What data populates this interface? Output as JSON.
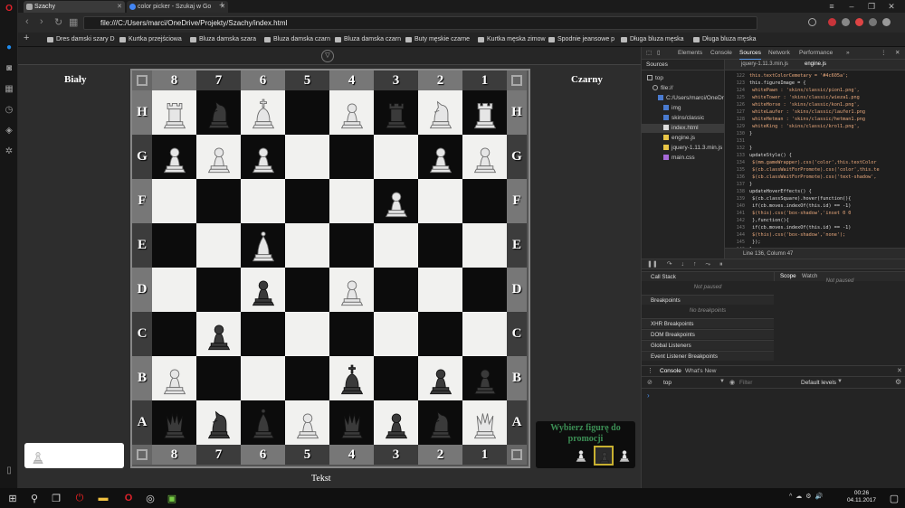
{
  "browser": {
    "tabs": [
      {
        "title": "Szachy",
        "active": true
      },
      {
        "title": "color picker - Szukaj w Go",
        "active": false
      }
    ],
    "url": "file:///C:/Users/marci/OneDrive/Projekty/Szachy/index.html",
    "bookmarks": [
      "Dres damski szary D",
      "Kurtka przejściowa",
      "Bluza damska szara",
      "Bluza damska czarn",
      "Bluza damska czarn",
      "Buty męskie czarne",
      "Kurtka męska zimow",
      "Spodnie jeansowe p",
      "Długa bluza męska",
      "Długa bluza męska"
    ]
  },
  "game": {
    "player_white": "Biały",
    "player_black": "Czarny",
    "files": [
      "8",
      "7",
      "6",
      "5",
      "4",
      "3",
      "2",
      "1"
    ],
    "ranks": [
      "H",
      "G",
      "F",
      "E",
      "D",
      "C",
      "B",
      "A"
    ],
    "board": [
      [
        "wR",
        "bN",
        "wK",
        "",
        "wP",
        "bR",
        "wN",
        "wR"
      ],
      [
        "wP",
        "wP",
        "wP",
        "",
        "",
        "",
        "wP",
        "wP"
      ],
      [
        "",
        "",
        "",
        "",
        "",
        "wP",
        "",
        ""
      ],
      [
        "",
        "",
        "wB",
        "",
        "",
        "",
        "",
        ""
      ],
      [
        "",
        "",
        "bP",
        "",
        "wP",
        "",
        "",
        ""
      ],
      [
        "",
        "bP",
        "",
        "",
        "",
        "",
        "",
        ""
      ],
      [
        "wP",
        "",
        "",
        "",
        "bK",
        "",
        "bP",
        "bP"
      ],
      [
        "bQ",
        "bN",
        "bB",
        "wP",
        "bQ",
        "bP",
        "bN",
        "wQ"
      ]
    ],
    "promotion_title": "Wybierz figurę do promocji",
    "promotion_pieces": [
      "wP",
      "bP",
      "wP"
    ],
    "captured_pieces": [
      "wP"
    ],
    "status_text": "Tekst"
  },
  "devtools": {
    "tabs": [
      "Elements",
      "Console",
      "Sources",
      "Network",
      "Performance"
    ],
    "sources_tabs": [
      "Sources",
      "jquery-1.11.3.min.js",
      "engine.js"
    ],
    "tree": [
      "top",
      "file://",
      "C:/Users/marci/OneDr",
      "img",
      "skins/classic",
      "index.html",
      "engine.js",
      "jquery-1.11.3.min.js",
      "main.css"
    ],
    "code": [
      {
        "ln": "122",
        "text": "this.textColorCemetary = '#4c605a';"
      },
      {
        "ln": "123",
        "text": "this.figureImage = {"
      },
      {
        "ln": "124",
        "text": "    whitePawn : 'skins/classic/pion1.png',"
      },
      {
        "ln": "125",
        "text": "    whiteTower : 'skins/classic/wieza1.png"
      },
      {
        "ln": "126",
        "text": "    whiteHorse : 'skins/classic/kon1.png',"
      },
      {
        "ln": "127",
        "text": "    whiteLaufer : 'skins/classic/laufer1.png"
      },
      {
        "ln": "128",
        "text": "    whiteHetman : 'skins/classic/hetman1.png"
      },
      {
        "ln": "129",
        "text": "    whiteKing : 'skins/classic/krol1.png',"
      },
      {
        "ln": "130",
        "text": "}"
      },
      {
        "ln": "131",
        "text": ""
      },
      {
        "ln": "132",
        "text": "}"
      },
      {
        "ln": "133",
        "text": "updateStyle() {"
      },
      {
        "ln": "134",
        "text": "  $(mm.gameWrapper).css('color',this.textColor"
      },
      {
        "ln": "135",
        "text": "  $(cb.classWaitForPromote).css('color',this.te"
      },
      {
        "ln": "136",
        "text": "  $(cb.classWaitForPromote).css('text-shadow',"
      },
      {
        "ln": "137",
        "text": "}"
      },
      {
        "ln": "138",
        "text": "updateHoverEffects() {"
      },
      {
        "ln": "139",
        "text": "  $(cb.classSquare).hover(function(){"
      },
      {
        "ln": "140",
        "text": "    if(cb.moves.indexOf(this.id) == -1)"
      },
      {
        "ln": "141",
        "text": "      $(this).css('box-shadow','inset 0 0"
      },
      {
        "ln": "142",
        "text": "  },function(){"
      },
      {
        "ln": "143",
        "text": "    if(cb.moves.indexOf(this.id) == -1)"
      },
      {
        "ln": "144",
        "text": "      $(this).css('box-shadow','none');"
      },
      {
        "ln": "145",
        "text": "  });"
      },
      {
        "ln": "146",
        "text": "}"
      }
    ],
    "cursor_position": "Line 136, Column 47",
    "call_stack": "Call Stack",
    "not_paused": "Not paused",
    "breakpoints": "Breakpoints",
    "no_breakpoints": "No breakpoints",
    "other_sections": [
      "XHR Breakpoints",
      "DOM Breakpoints",
      "Global Listeners",
      "Event Listener Breakpoints"
    ],
    "scope_tabs": [
      "Scope",
      "Watch"
    ],
    "console_tabs": [
      "Console",
      "What's New"
    ],
    "console_context": "top",
    "filter_placeholder": "Filter",
    "levels": "Default levels"
  },
  "taskbar": {
    "time": "00:26",
    "date": "04.11.2017"
  }
}
